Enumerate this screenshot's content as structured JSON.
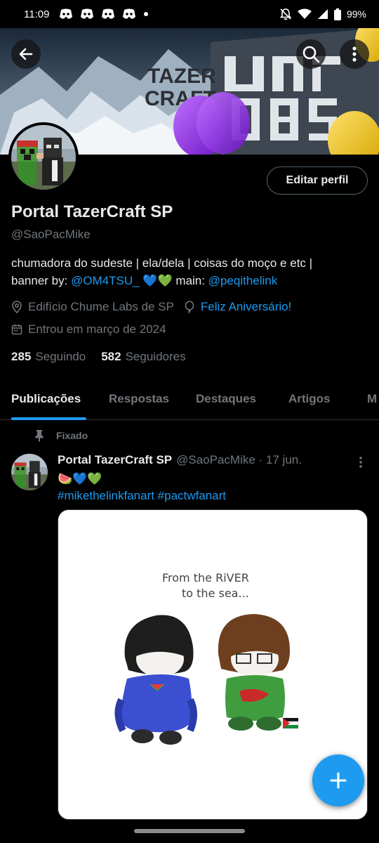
{
  "status_bar": {
    "time": "11:09",
    "notification_icons": [
      "discord-icon",
      "discord-icon",
      "discord-icon",
      "discord-icon",
      "dot-icon"
    ],
    "battery": "99%"
  },
  "banner": {
    "text_left": "TAZER",
    "text_left2": "CRAFT",
    "text_right": "CHUME",
    "text_right2": "LABS"
  },
  "profile": {
    "edit_button": "Editar perfil",
    "display_name": "Portal TazerCraft SP",
    "handle": "@SaoPacMike",
    "bio_line1": "chumadora do sudeste | ela/dela | coisas do moço e etc |",
    "bio_prefix": "banner by: ",
    "bio_mention1": "@OM4TSU_",
    "bio_emojis": " 💙💚 main: ",
    "bio_mention2": "@peqithelink",
    "location": "Edifício Chume Labs de SP",
    "birthday": "Feliz Aniversário!",
    "joined": "Entrou em março de 2024",
    "following_count": "285",
    "following_label": "Seguindo",
    "followers_count": "582",
    "followers_label": "Seguidores"
  },
  "tabs": [
    "Publicações",
    "Respostas",
    "Destaques",
    "Artigos",
    "M"
  ],
  "post": {
    "pinned_label": "Fixado",
    "author_name": "Portal TazerCraft SP",
    "author_handle": "@SaoPacMike · 17 jun.",
    "emoji_line": "🍉💙💚",
    "hashtags": "#mikethelinkfanart #pactwfanart",
    "image_caption_line1": "From the RiVER",
    "image_caption_line2": "to the sea..."
  },
  "colors": {
    "accent": "#1d9bf0",
    "muted": "#71767b",
    "text": "#e7e9ea",
    "background": "#000000",
    "border": "#2f3336"
  }
}
